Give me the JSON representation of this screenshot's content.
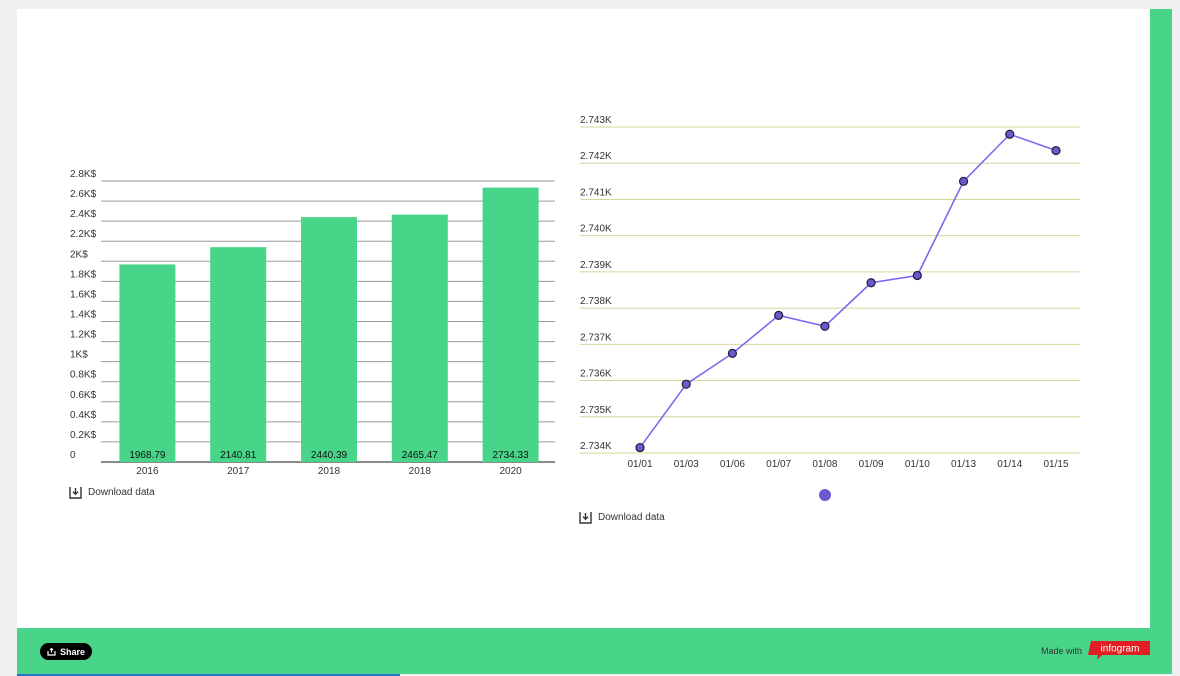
{
  "chart_data": [
    {
      "type": "bar",
      "categories": [
        "2016",
        "2017",
        "2018",
        "2018",
        "2020"
      ],
      "values": [
        1968.79,
        2140.81,
        2440.39,
        2465.47,
        2734.33
      ],
      "value_labels": [
        "1968.79",
        "2140.81",
        "2440.39",
        "2465.47",
        "2734.33"
      ],
      "ylim": [
        0,
        2800
      ],
      "yticks": [
        0,
        200,
        400,
        600,
        800,
        1000,
        1200,
        1400,
        1600,
        1800,
        2000,
        2200,
        2400,
        2600,
        2800
      ],
      "ytick_labels": [
        "0",
        "0.2K$",
        "0.4K$",
        "0.6K$",
        "0.8K$",
        "1K$",
        "1.2K$",
        "1.4K$",
        "1.6K$",
        "1.8K$",
        "2K$",
        "2.2K$",
        "2.4K$",
        "2.6K$",
        "2.8K$"
      ],
      "grid": true,
      "bar_color": "#48d58a"
    },
    {
      "type": "line",
      "x": [
        "01/01",
        "01/03",
        "01/06",
        "01/07",
        "01/08",
        "01/09",
        "01/10",
        "01/13",
        "01/14",
        "01/15"
      ],
      "values": [
        2734.15,
        2735.9,
        2736.75,
        2737.8,
        2737.5,
        2738.7,
        2738.9,
        2741.5,
        2742.8,
        2742.35
      ],
      "ylim": [
        2734,
        2743
      ],
      "yticks": [
        2734,
        2735,
        2736,
        2737,
        2738,
        2739,
        2740,
        2741,
        2742,
        2743
      ],
      "ytick_labels": [
        "2.734K",
        "2.735K",
        "2.736K",
        "2.737K",
        "2.738K",
        "2.739K",
        "2.740K",
        "2.741K",
        "2.742K",
        "2.743K"
      ],
      "grid": true,
      "line_color": "#7b68ee",
      "marker_color": "#6a5acd",
      "grid_color": "#d8d49a"
    }
  ],
  "download_label": "Download data",
  "footer": {
    "share_label": "Share",
    "made_with": "Made with",
    "brand": "infogram"
  },
  "colors": {
    "accent": "#48d58a",
    "brand_red": "#e01e24"
  }
}
